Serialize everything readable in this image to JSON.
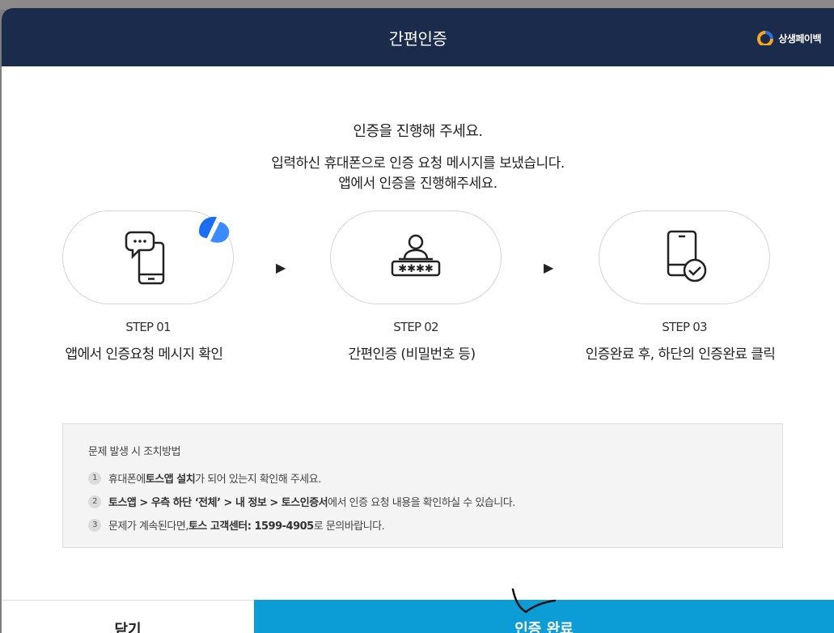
{
  "header": {
    "title": "간편인증",
    "brand": "상생페이백"
  },
  "intro": {
    "line1": "인증을 진행해 주세요.",
    "line2": "입력하신 휴대폰으로 인증 요청 메시지를 보냈습니다.",
    "line3": "앱에서 인증을 진행해주세요."
  },
  "steps": [
    {
      "num": "STEP 01",
      "desc": "앱에서 인증요청 메시지 확인",
      "icon": "phone-message-icon"
    },
    {
      "num": "STEP 02",
      "desc": "간편인증 (비밀번호 등)",
      "icon": "user-password-icon"
    },
    {
      "num": "STEP 03",
      "desc": "인증완료 후, 하단의 인증완료 클릭",
      "icon": "phone-check-icon"
    }
  ],
  "arrow_glyph": "▶",
  "help": {
    "title": "문제 발생 시 조치방법",
    "items": [
      {
        "n": "1",
        "pre": "휴대폰에 ",
        "bold": "토스앱 설치",
        "post": "가 되어 있는지 확인해 주세요."
      },
      {
        "n": "2",
        "pre": "",
        "bold": "토스앱 > 우측 하단 ‘전체’ > 내 정보 > 토스인증서",
        "post": "에서 인증 요청 내용을 확인하실 수 있습니다."
      },
      {
        "n": "3",
        "pre": "문제가 계속된다면, ",
        "bold": "토스 고객센터: 1599-4905",
        "post": "로 문의바랍니다."
      }
    ]
  },
  "footer": {
    "close_label": "닫기",
    "done_label": "인증 완료"
  },
  "colors": {
    "header_bg": "#1b2b4b",
    "primary": "#0d9dd6",
    "toss_blue": "#1a6ef5"
  }
}
